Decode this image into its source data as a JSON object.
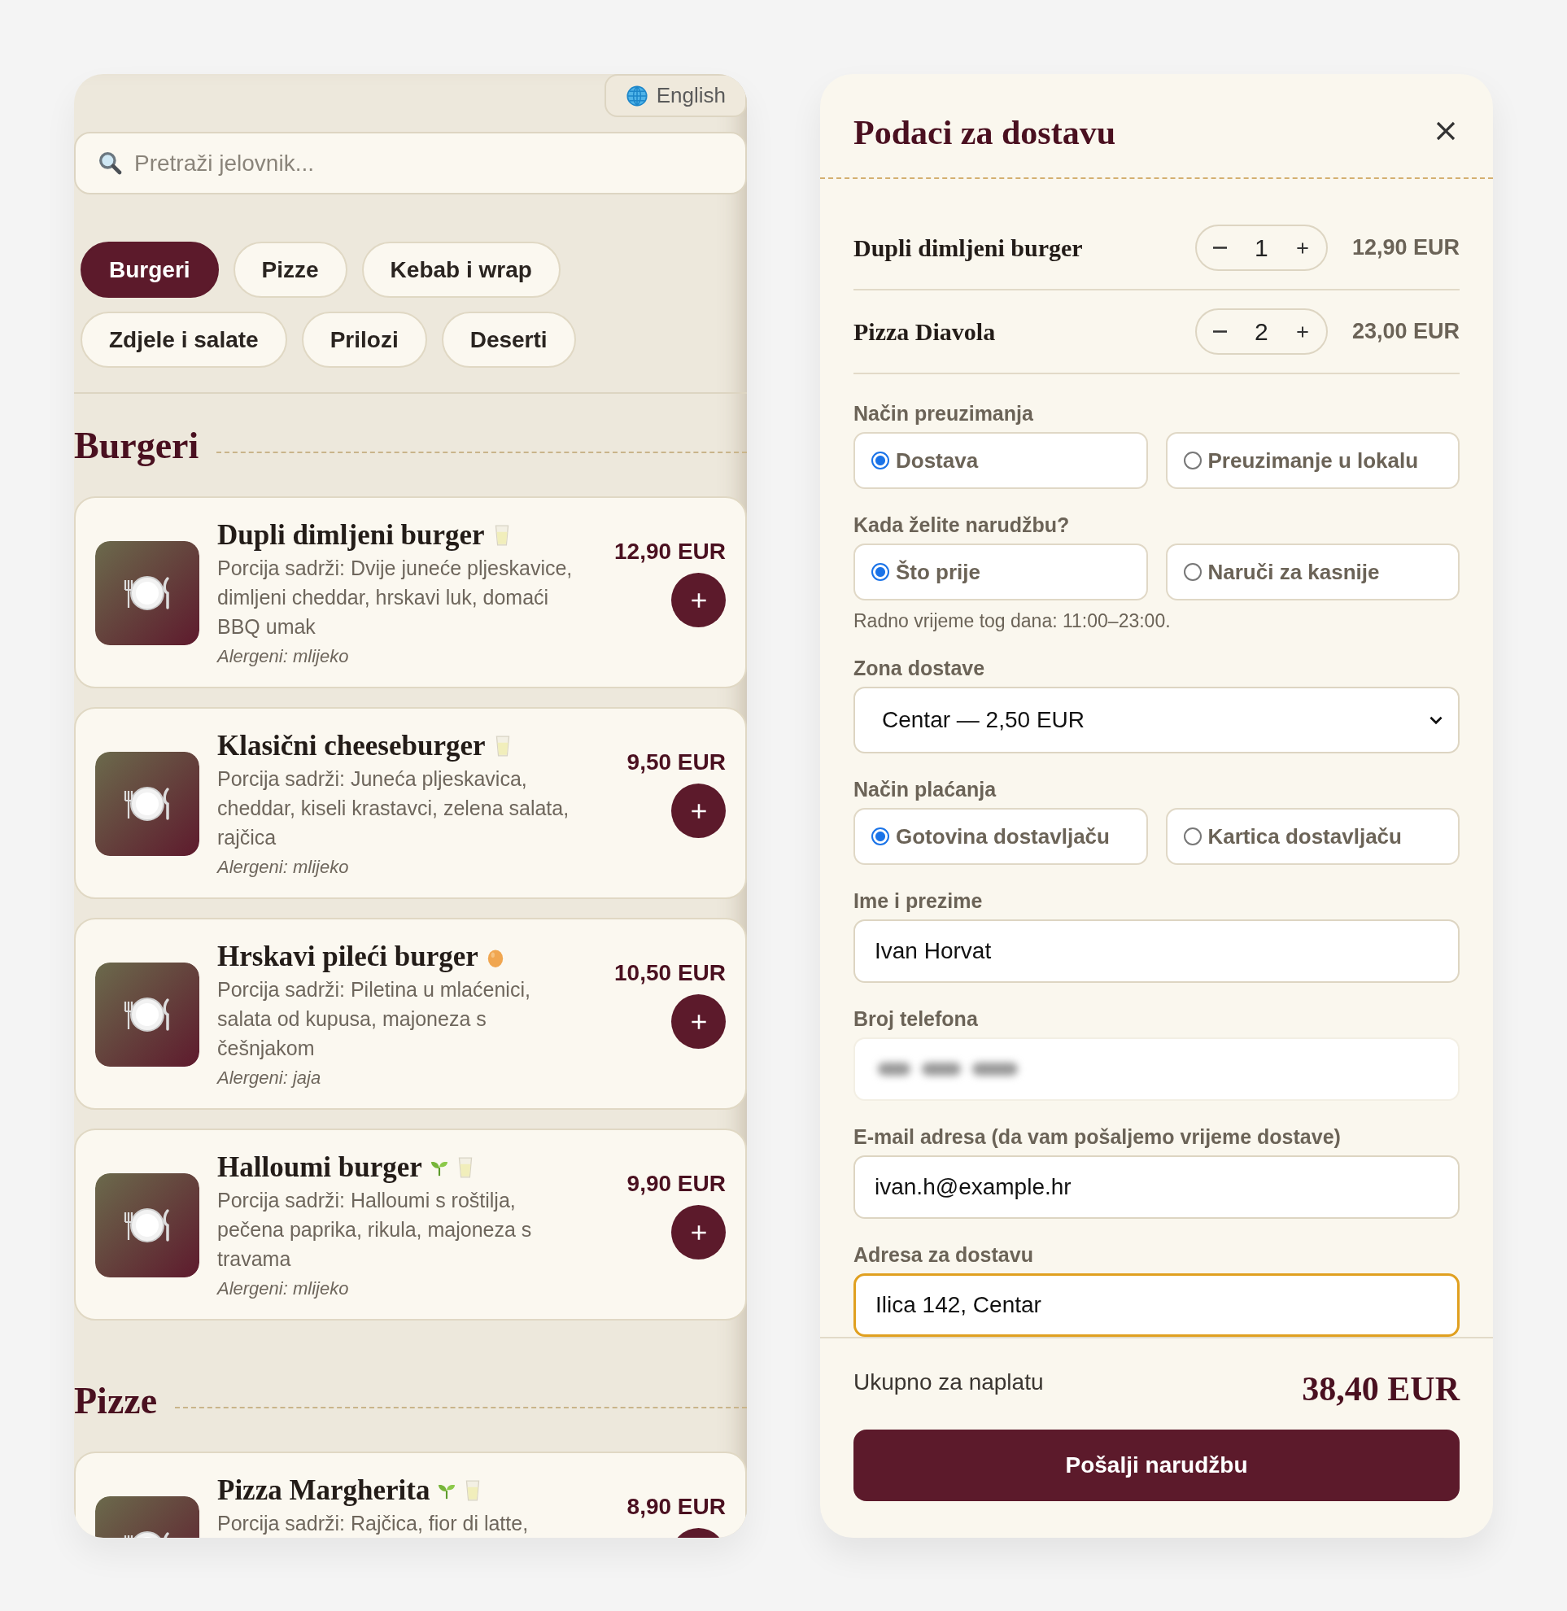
{
  "language_button": {
    "label": "English"
  },
  "search": {
    "placeholder": "Pretraži jelovnik..."
  },
  "categories": [
    {
      "label": "Burgeri",
      "selected": true
    },
    {
      "label": "Pizze",
      "selected": false
    },
    {
      "label": "Kebab i wrap",
      "selected": false
    },
    {
      "label": "Zdjele i salate",
      "selected": false
    },
    {
      "label": "Prilozi",
      "selected": false
    },
    {
      "label": "Deserti",
      "selected": false
    }
  ],
  "sections": [
    {
      "title": "Burgeri",
      "items": [
        {
          "name": "Dupli dimljeni burger",
          "badges": [
            {
              "kind": "milk"
            }
          ],
          "description": "Porcija sadrži: Dvije juneće pljeskavice, dimljeni cheddar, hrskavi luk, domaći BBQ umak",
          "allergens": "Alergeni: mlijeko",
          "price": "12,90 EUR"
        },
        {
          "name": "Klasični cheeseburger",
          "badges": [
            {
              "kind": "milk"
            }
          ],
          "description": "Porcija sadrži: Juneća pljeskavica, cheddar, kiseli krastavci, zelena salata, rajčica",
          "allergens": "Alergeni: mlijeko",
          "price": "9,50 EUR"
        },
        {
          "name": "Hrskavi pileći burger",
          "badges": [
            {
              "kind": "egg"
            }
          ],
          "description": "Porcija sadrži: Piletina u mlaćenici, salata od kupusa, majoneza s češnjakom",
          "allergens": "Alergeni: jaja",
          "price": "10,50 EUR"
        },
        {
          "name": "Halloumi burger",
          "badges": [
            {
              "kind": "vegetarian"
            },
            {
              "kind": "milk"
            }
          ],
          "description": "Porcija sadrži: Halloumi s roštilja, pečena paprika, rikula, majoneza s travama",
          "allergens": "Alergeni: mlijeko",
          "price": "9,90 EUR"
        }
      ]
    },
    {
      "title": "Pizze",
      "items": [
        {
          "name": "Pizza Margherita",
          "badges": [
            {
              "kind": "vegetarian"
            },
            {
              "kind": "milk"
            }
          ],
          "description": "Porcija sadrži: Rajčica, fior di latte,",
          "price": "8,90 EUR"
        }
      ]
    }
  ],
  "checkout": {
    "title": "Podaci za dostavu",
    "cart": [
      {
        "name": "Dupli dimljeni burger",
        "quantity": "1",
        "price": "12,90 EUR"
      },
      {
        "name": "Pizza Diavola",
        "quantity": "2",
        "price": "23,00 EUR"
      }
    ],
    "fields": [
      {
        "kind": "radio",
        "label": "Način preuzimanja",
        "options": [
          {
            "label": "Dostava",
            "selected": true
          },
          {
            "label": "Preuzimanje u lokalu",
            "selected": false
          }
        ]
      },
      {
        "kind": "radio",
        "label": "Kada želite narudžbu?",
        "options": [
          {
            "label": "Što prije",
            "selected": true
          },
          {
            "label": "Naruči za kasnije",
            "selected": false
          }
        ],
        "hint": "Radno vrijeme tog dana: 11:00–23:00."
      },
      {
        "kind": "select",
        "label": "Zona dostave",
        "value": "Centar — 2,50 EUR"
      },
      {
        "kind": "radio",
        "label": "Način plaćanja",
        "options": [
          {
            "label": "Gotovina dostavljaču",
            "selected": true
          },
          {
            "label": "Kartica dostavljaču",
            "selected": false
          }
        ]
      },
      {
        "kind": "text",
        "label": "Ime i prezime",
        "value": "Ivan Horvat",
        "focused": false
      },
      {
        "kind": "redacted",
        "label": "Broj telefona"
      },
      {
        "kind": "text",
        "label": "E-mail adresa (da vam pošaljemo vrijeme dostave)",
        "value": "ivan.h@example.hr",
        "focused": false
      },
      {
        "kind": "text",
        "label": "Adresa za dostavu",
        "value": "Ilica 142, Centar",
        "focused": true
      }
    ],
    "total_label": "Ukupno za naplatu",
    "total": "38,40 EUR",
    "submit_button": "Pošalji narudžbu"
  }
}
